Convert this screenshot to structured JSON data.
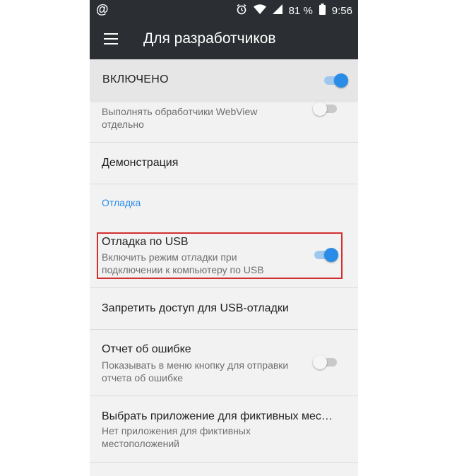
{
  "status_bar": {
    "left_icon": "@",
    "battery": "81 %",
    "time": "9:56",
    "icons": [
      "alarm-icon",
      "wifi-icon",
      "signal-icon",
      "battery-icon"
    ]
  },
  "app_bar": {
    "title": "Для разработчиков",
    "menu_icon": "hamburger-menu-icon"
  },
  "master_switch": {
    "label": "ВКЛЮЧЕНО",
    "on": true
  },
  "settings": {
    "webview": {
      "subtitle": "Выполнять обработчики WebView отдельно",
      "on": false
    },
    "demo": {
      "title": "Демонстрация"
    },
    "section_debug": "Отладка",
    "usb_debug": {
      "title": "Отладка по USB",
      "subtitle": "Включить режим отладки при подключении к компьютеру по USB",
      "on": true
    },
    "revoke_usb": {
      "title": "Запретить доступ для USB-отладки"
    },
    "bug_report": {
      "title": "Отчет об ошибке",
      "subtitle": "Показывать в меню кнопку для отправки отчета об ошибке",
      "on": false
    },
    "mock_location": {
      "title": "Выбрать приложение для фиктивных мес…",
      "subtitle": "Нет приложения для фиктивных местоположений"
    }
  },
  "colors": {
    "app_bar": "#2b2f33",
    "accent": "#2b8ce8",
    "highlight_border": "#d32f2f",
    "background": "#f2f2f2"
  }
}
